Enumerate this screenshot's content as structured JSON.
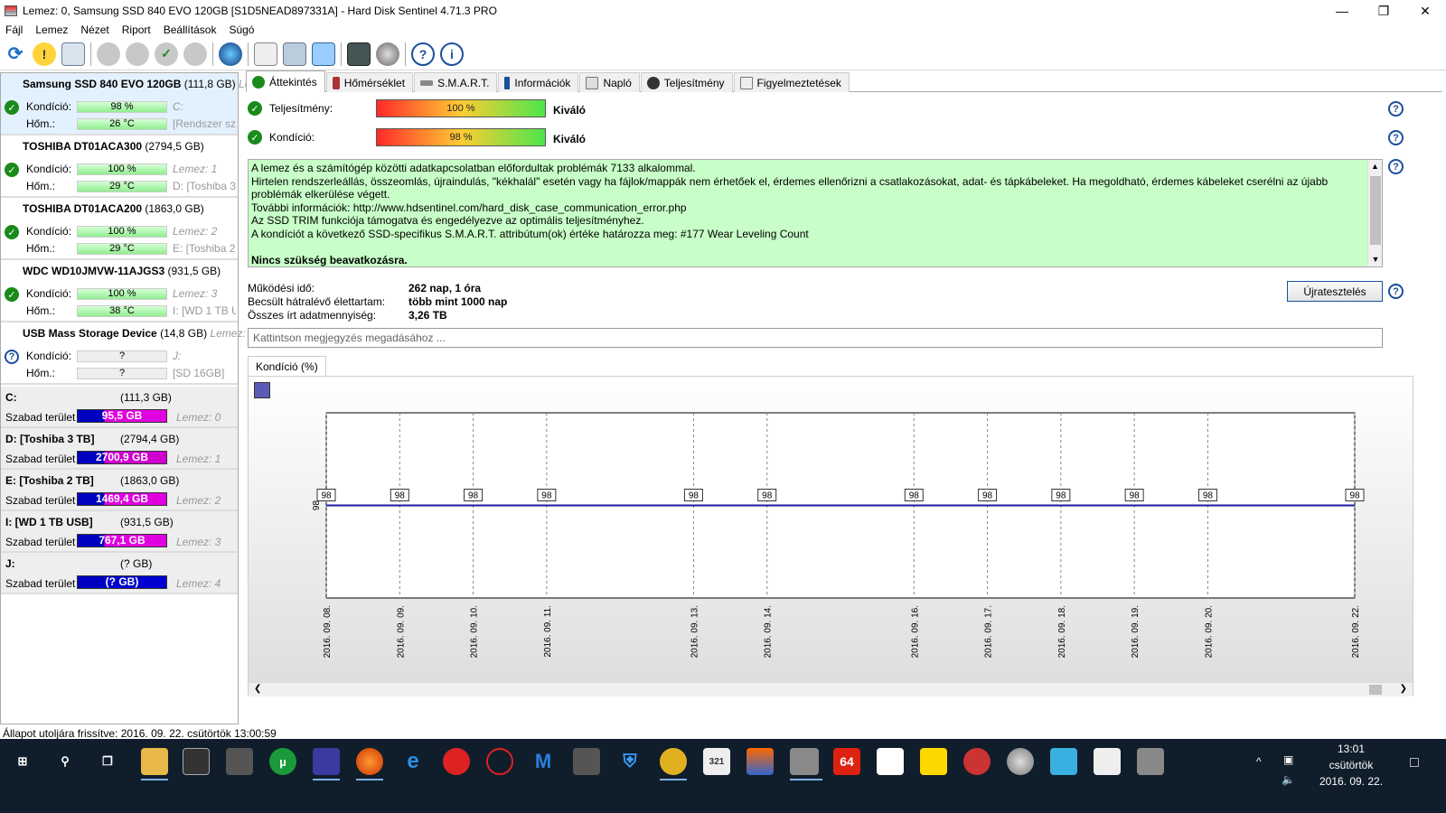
{
  "window": {
    "title": "Lemez: 0, Samsung SSD 840 EVO 120GB [S1D5NEAD897331A]  -  Hard Disk Sentinel 4.71.3 PRO"
  },
  "menu": [
    "Fájl",
    "Lemez",
    "Nézet",
    "Riport",
    "Beállítások",
    "Súgó"
  ],
  "disks": [
    {
      "name": "Samsung SSD 840 EVO 120GB",
      "cap": "(111,8 GB)",
      "cap2": "Le",
      "cond_label": "Kondíció:",
      "cond": "98 %",
      "temp_label": "Hőm.:",
      "temp": "26 °C",
      "aux1": "C:",
      "aux2": "[Rendszer szá",
      "status": "ok"
    },
    {
      "name": "TOSHIBA DT01ACA300",
      "cap": "(2794,5 GB)",
      "cap2": "",
      "cond_label": "Kondíció:",
      "cond": "100 %",
      "temp_label": "Hőm.:",
      "temp": "29 °C",
      "aux1": "Lemez: 1",
      "aux2": "D: [Toshiba 3",
      "status": "ok"
    },
    {
      "name": "TOSHIBA DT01ACA200",
      "cap": "(1863,0 GB)",
      "cap2": "",
      "cond_label": "Kondíció:",
      "cond": "100 %",
      "temp_label": "Hőm.:",
      "temp": "29 °C",
      "aux1": "Lemez: 2",
      "aux2": "E: [Toshiba 2",
      "status": "ok"
    },
    {
      "name": "WDC WD10JMVW-11AJGS3",
      "cap": "(931,5 GB)",
      "cap2": "",
      "cond_label": "Kondíció:",
      "cond": "100 %",
      "temp_label": "Hőm.:",
      "temp": "38 °C",
      "aux1": "Lemez: 3",
      "aux2": "I: [WD 1 TB U",
      "status": "ok"
    },
    {
      "name": "USB Mass Storage Device",
      "cap": "(14,8 GB)",
      "cap2": "Lemez:",
      "cond_label": "Kondíció:",
      "cond": "?",
      "temp_label": "Hőm.:",
      "temp": "?",
      "aux1": "J:",
      "aux2": "[SD 16GB]",
      "status": "unknown"
    }
  ],
  "volumes": [
    {
      "name": "C:",
      "cap": "(111,3 GB)",
      "free_label": "Szabad terület",
      "free": "95,5 GB",
      "disk": "Lemez: 0",
      "color": "#e000e0"
    },
    {
      "name": "D: [Toshiba 3 TB]",
      "cap": "(2794,4 GB)",
      "free_label": "Szabad terület",
      "free": "2700,9 GB",
      "disk": "Lemez: 1",
      "color": "#d000d0"
    },
    {
      "name": "E: [Toshiba 2 TB]",
      "cap": "(1863,0 GB)",
      "free_label": "Szabad terület",
      "free": "1469,4 GB",
      "disk": "Lemez: 2",
      "color": "#e000e0"
    },
    {
      "name": "I: [WD 1 TB USB]",
      "cap": "(931,5 GB)",
      "free_label": "Szabad terület",
      "free": "767,1 GB",
      "disk": "Lemez: 3",
      "color": "#e000e0"
    },
    {
      "name": "J:",
      "cap": "(? GB)",
      "free_label": "Szabad terület",
      "free": "(? GB)",
      "disk": "Lemez: 4",
      "color": "#0000d0"
    }
  ],
  "tabs": [
    "Áttekintés",
    "Hőmérséklet",
    "S.M.A.R.T.",
    "Információk",
    "Napló",
    "Teljesítmény",
    "Figyelmeztetések"
  ],
  "overview": {
    "perf_label": "Teljesítmény:",
    "perf_value": "100 %",
    "perf_rating": "Kiváló",
    "cond_label": "Kondíció:",
    "cond_value": "98 %",
    "cond_rating": "Kiváló",
    "messages": [
      "A lemez és a számítógép közötti adatkapcsolatban előfordultak problémák 7133 alkalommal.",
      "Hirtelen rendszerleállás, összeomlás, újraindulás, \"kékhalál\" esetén vagy ha fájlok/mappák nem érhetőek el, érdemes ellenőrizni a csatlakozásokat, adat- és tápkábeleket. Ha megoldható, érdemes kábeleket cserélni az újabb problémák elkerülése végett.",
      "További információk: http://www.hdsentinel.com/hard_disk_case_communication_error.php",
      "Az SSD TRIM funkciója támogatva és engedélyezve az optimális teljesítményhez.",
      "A kondíciót a következő SSD-specifikus S.M.A.R.T. attribútum(ok) értéke határozza meg:  #177 Wear Leveling Count"
    ],
    "action": "Nincs szükség beavatkozásra.",
    "uptime_label": "Működési idő:",
    "uptime": "262 nap, 1 óra",
    "remaining_label": "Becsült hátralévő élettartam:",
    "remaining": "több mint 1000 nap",
    "written_label": "Összes írt adatmennyiség:",
    "written": "3,26 TB",
    "retest_button": "Újratesztelés",
    "note_placeholder": "Kattintson megjegyzés megadásához ..."
  },
  "chart_tab": "Kondíció  (%)",
  "chart_data": {
    "type": "line",
    "x": [
      "2016. 09. 08.",
      "2016. 09. 09.",
      "2016. 09. 10.",
      "2016. 09. 11.",
      "2016. 09. 13.",
      "2016. 09. 14.",
      "2016. 09. 16.",
      "2016. 09. 17.",
      "2016. 09. 18.",
      "2016. 09. 19.",
      "2016. 09. 20.",
      "2016. 09. 22."
    ],
    "x_days": [
      8,
      9,
      10,
      11,
      13,
      14,
      16,
      17,
      18,
      19,
      20,
      22
    ],
    "values": [
      98,
      98,
      98,
      98,
      98,
      98,
      98,
      98,
      98,
      98,
      98,
      98
    ],
    "y_tick": "98",
    "series_color": "#1a1aa0",
    "grid": true
  },
  "status": "Állapot utoljára frissítve: 2016. 09. 22. csütörtök 13:00:59",
  "taskbar": {
    "time": "13:01",
    "day": "csütörtök",
    "date": "2016. 09. 22."
  }
}
